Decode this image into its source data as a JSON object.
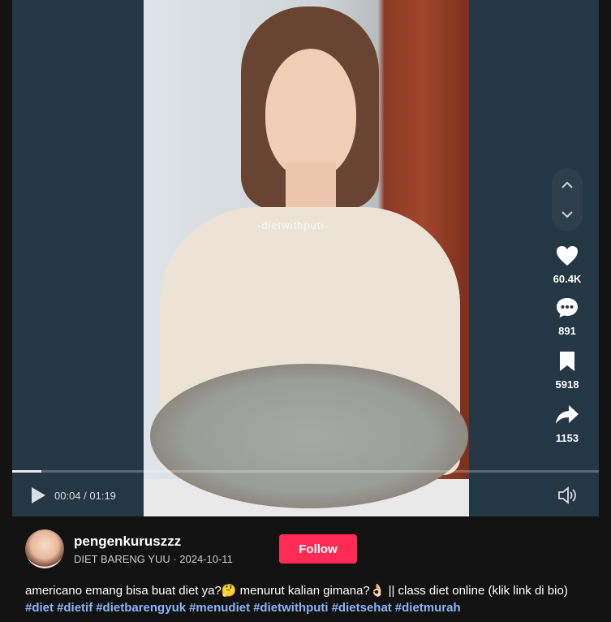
{
  "video": {
    "watermark": "-dietwithputi-",
    "time_text": "00:04 / 01:19",
    "progress_fraction": 0.05
  },
  "nav": {
    "up_icon": "chevron-up-icon",
    "down_icon": "chevron-down-icon"
  },
  "actions": {
    "likes": "60.4K",
    "comments": "891",
    "saves": "5918",
    "shares": "1153"
  },
  "author": {
    "username": "pengenkuruszzz",
    "subline": "DIET BARENG YUU · 2024-10-11"
  },
  "follow_label": "Follow",
  "caption": "americano emang bisa buat diet ya?🤔 menurut kalian gimana?👌🏻 || class diet online (klik link di bio)",
  "hashtags": [
    "#diet",
    "#dietif",
    "#dietbarengyuk",
    "#menudiet",
    "#dietwithputi",
    "#dietsehat",
    "#dietmurah"
  ],
  "colors": {
    "accent": "#fe2c55",
    "hashtag": "#8ab4f8",
    "player_bg": "#233744"
  }
}
